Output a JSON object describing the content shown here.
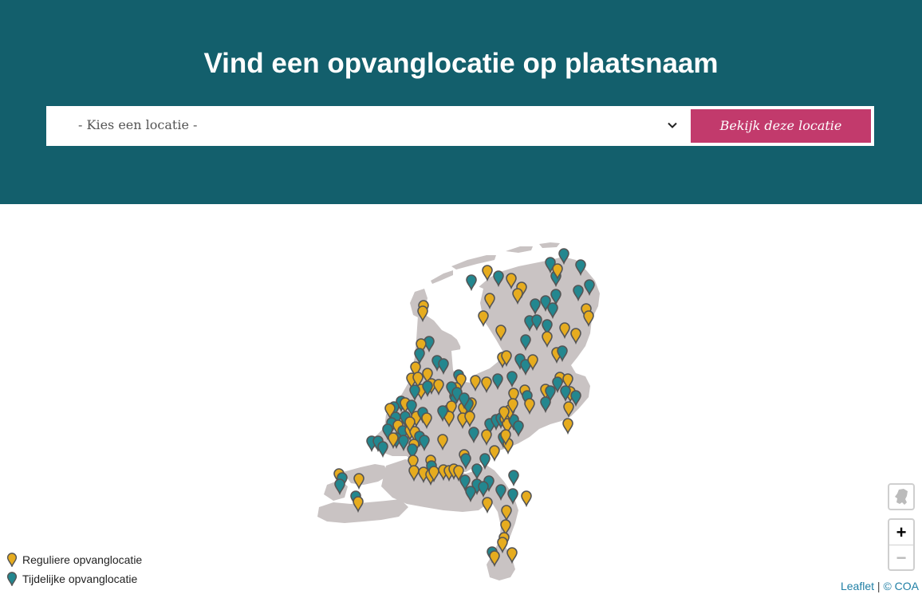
{
  "header": {
    "title": "Vind een opvanglocatie op plaatsnaam",
    "select_placeholder": "- Kies een locatie -",
    "button_label": "Bekijk deze locatie"
  },
  "legend": {
    "regular": "Reguliere opvanglocatie",
    "temporary": "Tijdelijke opvanglocatie"
  },
  "attribution": {
    "leaflet": "Leaflet",
    "separator": " | ",
    "coa": "© COA"
  },
  "controls": {
    "zoom_in": "+",
    "zoom_out": "−",
    "home_icon": "netherlands-map-icon"
  },
  "colors": {
    "header_bg": "#135f6c",
    "button_bg": "#c23a6c",
    "land": "#c9c3c3",
    "marker_regular": "#e6ac1f",
    "marker_temporary": "#23878f",
    "marker_outline": "#555555",
    "link": "#1f7fa5"
  }
}
